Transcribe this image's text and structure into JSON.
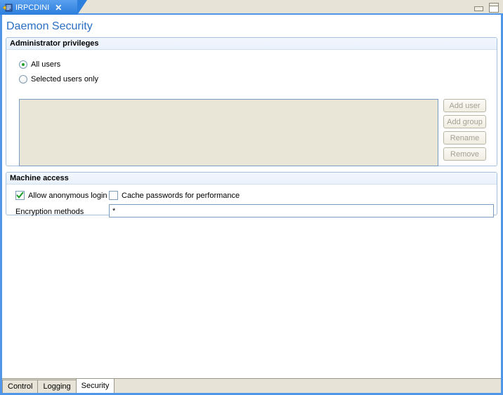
{
  "window": {
    "editor_tab": {
      "label": "IRPCDINI",
      "close_label": "✕",
      "icon": "ini-file-icon"
    },
    "minimize_title": "Minimize",
    "maximize_title": "Maximize"
  },
  "page": {
    "title": "Daemon Security"
  },
  "admin_group": {
    "header": "Administrator privileges",
    "radios": [
      {
        "label": "All users",
        "selected": true
      },
      {
        "label": "Selected users only",
        "selected": false
      }
    ],
    "list": {
      "items": [],
      "empty_text": ""
    },
    "buttons": [
      {
        "label": "Add user",
        "enabled": false
      },
      {
        "label": "Add group",
        "enabled": false
      },
      {
        "label": "Rename",
        "enabled": false
      },
      {
        "label": "Remove",
        "enabled": false
      }
    ]
  },
  "machine_group": {
    "header": "Machine access",
    "checkboxes": [
      {
        "label": "Allow anonymous login",
        "checked": true
      },
      {
        "label": "Cache passwords for performance",
        "checked": false
      }
    ],
    "encryption": {
      "label": "Encryption methods",
      "value": "*",
      "placeholder": ""
    }
  },
  "bottom_tabs": [
    {
      "label": "Control",
      "active": false
    },
    {
      "label": "Logging",
      "active": false
    },
    {
      "label": "Security",
      "active": true
    }
  ],
  "colors": {
    "accent_blue": "#4f96e8",
    "title_blue": "#2a6fc4",
    "group_border": "#a5c3e0",
    "list_bg": "#e9e6d8",
    "chrome_bg": "#e7e4d7",
    "check_green": "#1f9d28",
    "disabled_text": "#a3a192"
  }
}
